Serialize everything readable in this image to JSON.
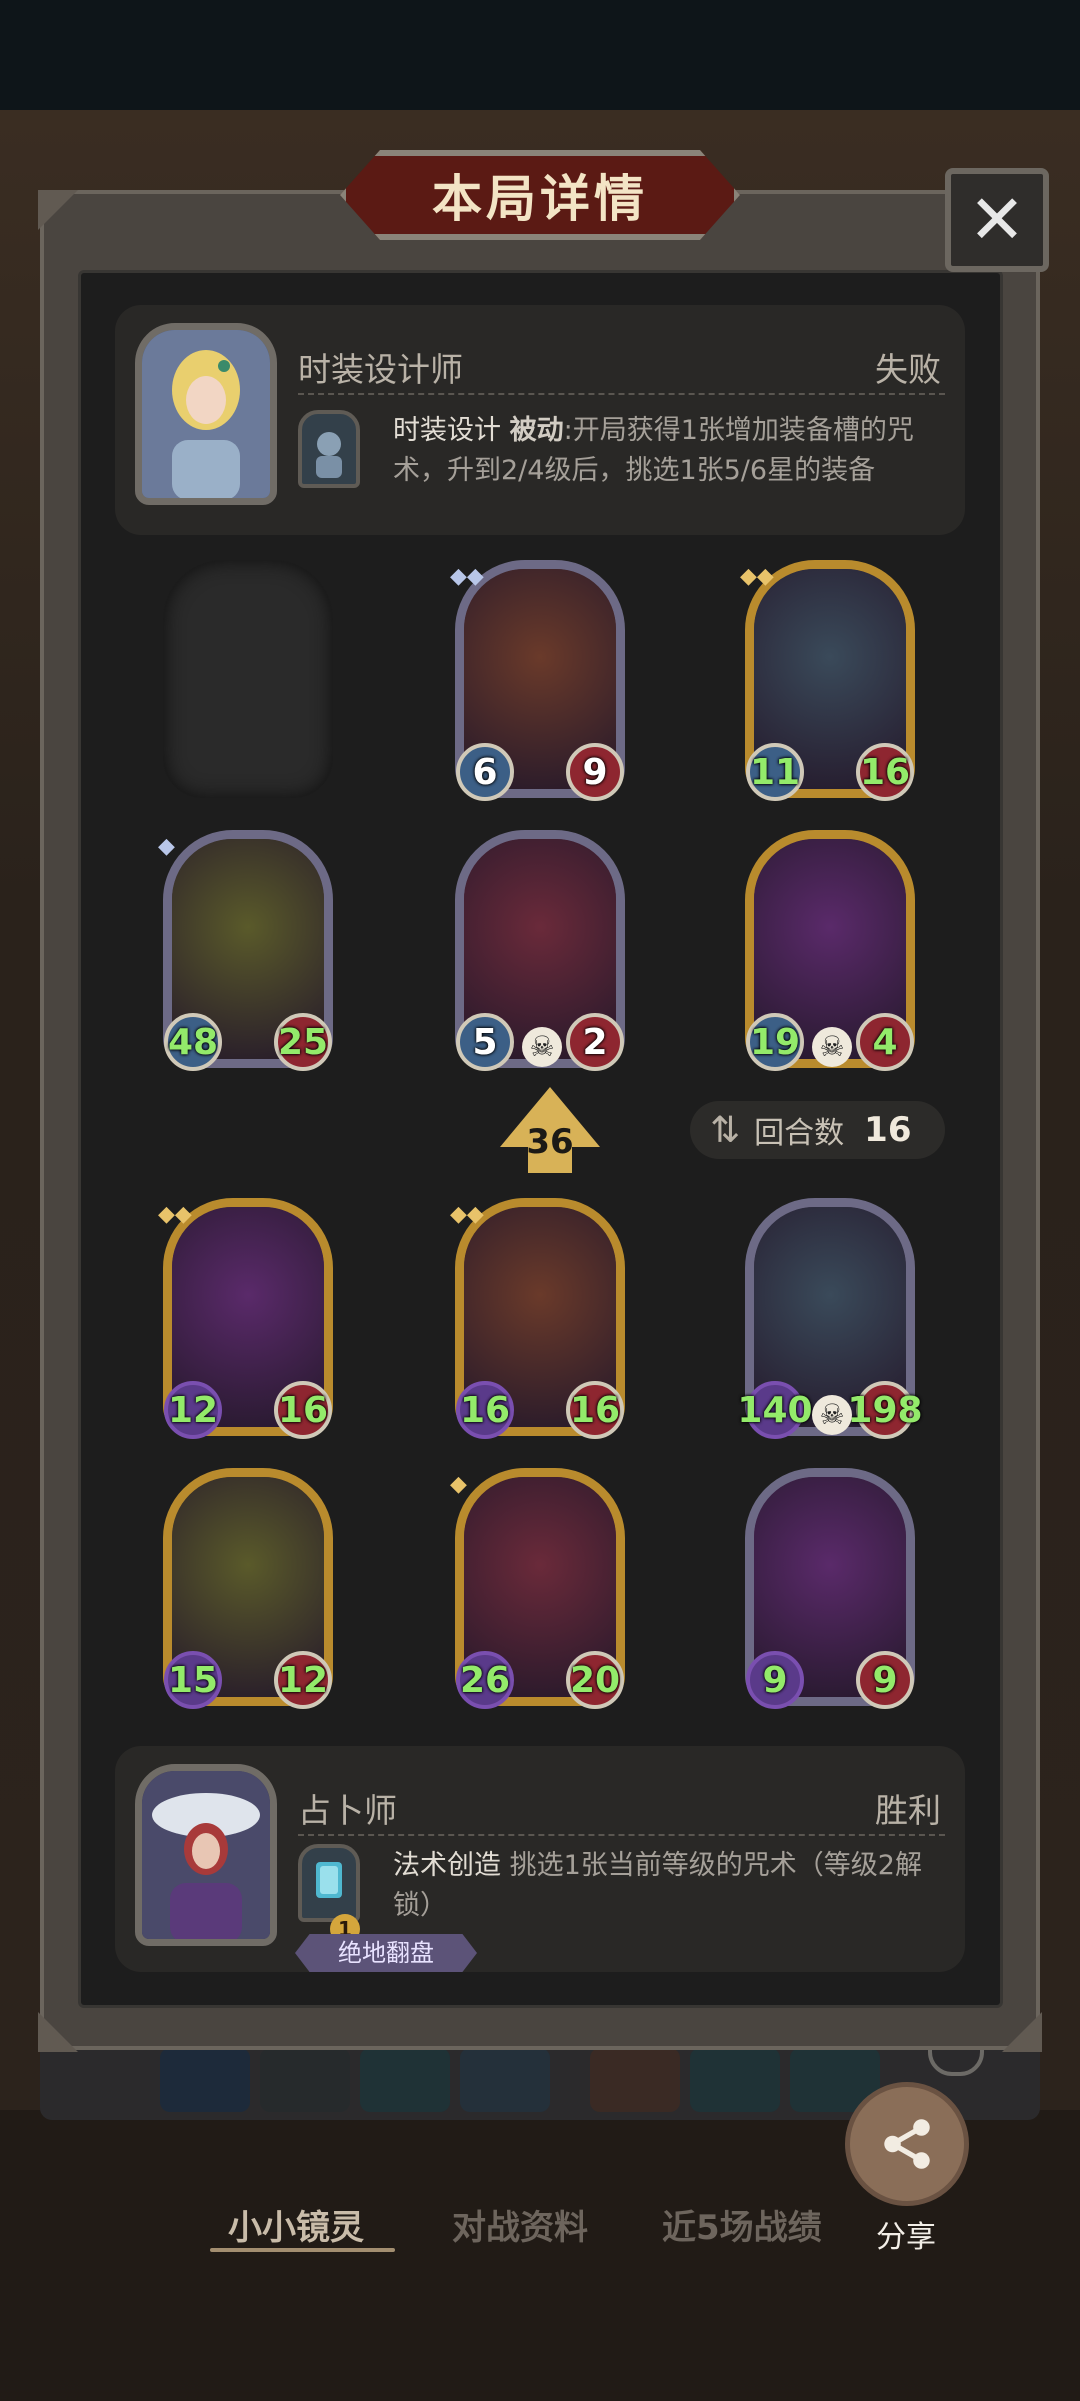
{
  "modal": {
    "title": "本局详情",
    "close_icon": "close-icon"
  },
  "top_player": {
    "hero_name": "时装设计师",
    "result": "失败",
    "skill_name": "时装设计",
    "skill_type": "被动",
    "skill_desc": ":开局获得1张增加装备槽的咒术，升到2/4级后，挑选1张5/6星的装备",
    "portrait_icon": "fashion-designer-portrait",
    "skill_icon": "fashion-skill-icon"
  },
  "top_board": [
    {
      "empty": true
    },
    {
      "atk": "6",
      "hp": "9",
      "frame": "purple",
      "stars": "◆◆",
      "star_color": "silver",
      "atk_style": "blue",
      "hp_style": "red"
    },
    {
      "atk": "11",
      "hp": "16",
      "frame": "gold",
      "stars": "◆◆",
      "star_color": "gold",
      "atk_style": "red-green",
      "hp_style": "red-green"
    },
    {
      "atk": "48",
      "hp": "25",
      "frame": "purple",
      "stars": "◆",
      "star_color": "silver",
      "atk_style": "green",
      "hp_style": "green"
    },
    {
      "atk": "5",
      "hp": "2",
      "frame": "purple",
      "stars": "",
      "star_color": "silver",
      "atk_style": "blue",
      "hp_style": "red",
      "skull": true
    },
    {
      "atk": "19",
      "hp": "4",
      "frame": "gold",
      "stars": "",
      "star_color": "gold",
      "atk_style": "green",
      "hp_style": "red-green",
      "skull": true
    }
  ],
  "middle": {
    "level_value": "36",
    "rounds_label": "回合数",
    "rounds_value": "16"
  },
  "bottom_board": [
    {
      "atk": "12",
      "hp": "16",
      "frame": "gold",
      "stars": "◆◆",
      "star_color": "gold"
    },
    {
      "atk": "16",
      "hp": "16",
      "frame": "gold",
      "stars": "◆◆",
      "star_color": "gold"
    },
    {
      "atk": "140",
      "hp": "198",
      "frame": "purple",
      "stars": "",
      "star_color": "gold",
      "skull": true
    },
    {
      "atk": "15",
      "hp": "12",
      "frame": "gold",
      "stars": "",
      "star_color": "gold"
    },
    {
      "atk": "26",
      "hp": "20",
      "frame": "gold",
      "stars": "◆",
      "star_color": "gold"
    },
    {
      "atk": "9",
      "hp": "9",
      "frame": "purple",
      "stars": "",
      "star_color": "gold"
    }
  ],
  "bottom_player": {
    "hero_name": "占卜师",
    "result": "胜利",
    "skill_name": "法术创造",
    "skill_desc": " 挑选1张当前等级的咒术（等级2解锁）",
    "level_badge": "1",
    "tag_label": "绝地翻盘",
    "portrait_icon": "fortune-teller-portrait",
    "skill_icon": "spell-card-icon"
  },
  "nav": {
    "tab1": "小小镜灵",
    "tab2": "对战资料",
    "tab3": "近5场战绩"
  },
  "share": {
    "label": "分享"
  },
  "colors": {
    "accent_gold": "#b98b2d",
    "frame_purple": "#6d6a86",
    "stat_green": "#93ea6a",
    "title_red": "#5b1a14"
  }
}
